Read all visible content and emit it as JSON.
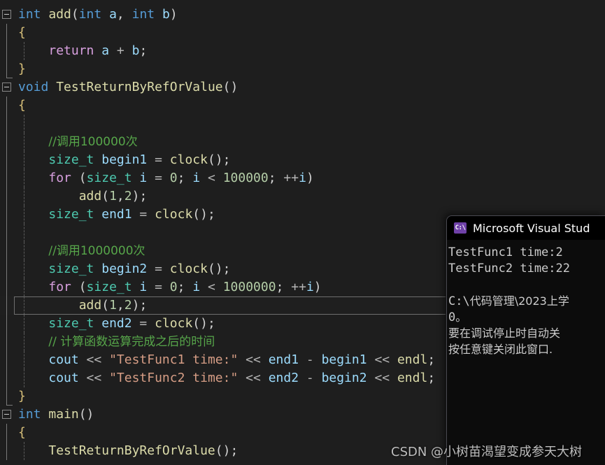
{
  "editor": {
    "background": "#1e1e1e",
    "colors": {
      "keyword": "#569cd6",
      "control_keyword": "#d8a0df",
      "type": "#4ec9b0",
      "function": "#dcdcaa",
      "variable": "#9cdcfe",
      "number": "#b5cea8",
      "string": "#d69d85",
      "comment": "#57a64a",
      "punctuation": "#d4d4d4",
      "current_line_border": "#6e6e6e"
    },
    "lines": [
      {
        "n": 1,
        "fold": "open",
        "guide": "none",
        "tokens": [
          {
            "t": "int",
            "c": "kw"
          },
          {
            "t": " ",
            "c": "pun"
          },
          {
            "t": "add",
            "c": "fn"
          },
          {
            "t": "(",
            "c": "pun"
          },
          {
            "t": "int",
            "c": "kw"
          },
          {
            "t": " a",
            "c": "var"
          },
          {
            "t": ", ",
            "c": "pun"
          },
          {
            "t": "int",
            "c": "kw"
          },
          {
            "t": " b",
            "c": "var"
          },
          {
            "t": ")",
            "c": "pun"
          }
        ]
      },
      {
        "n": 2,
        "fold": "bar",
        "guide": "none",
        "tokens": [
          {
            "t": "{",
            "c": "brc"
          }
        ]
      },
      {
        "n": 3,
        "fold": "bar",
        "guide": "dash",
        "tokens": [
          {
            "t": "    ",
            "c": "pun"
          },
          {
            "t": "return",
            "c": "kw2"
          },
          {
            "t": " a ",
            "c": "var"
          },
          {
            "t": "+",
            "c": "op"
          },
          {
            "t": " b",
            "c": "var"
          },
          {
            "t": ";",
            "c": "pun"
          }
        ]
      },
      {
        "n": 4,
        "fold": "barend",
        "guide": "none",
        "tokens": [
          {
            "t": "}",
            "c": "brc"
          }
        ]
      },
      {
        "n": 5,
        "fold": "open",
        "guide": "none",
        "tokens": [
          {
            "t": "void",
            "c": "kw"
          },
          {
            "t": " ",
            "c": "pun"
          },
          {
            "t": "TestReturnByRefOrValue",
            "c": "fn"
          },
          {
            "t": "()",
            "c": "pun"
          }
        ]
      },
      {
        "n": 6,
        "fold": "bar",
        "guide": "none",
        "tokens": [
          {
            "t": "{",
            "c": "brc"
          }
        ]
      },
      {
        "n": 7,
        "fold": "bar",
        "guide": "dash",
        "tokens": []
      },
      {
        "n": 8,
        "fold": "bar",
        "guide": "dash",
        "tokens": [
          {
            "t": "    ",
            "c": "pun"
          },
          {
            "t": "//调用100000次",
            "c": "cmt cjk"
          }
        ]
      },
      {
        "n": 9,
        "fold": "bar",
        "guide": "dash",
        "tokens": [
          {
            "t": "    ",
            "c": "pun"
          },
          {
            "t": "size_t",
            "c": "type"
          },
          {
            "t": " begin1 ",
            "c": "var"
          },
          {
            "t": "=",
            "c": "op"
          },
          {
            "t": " ",
            "c": "pun"
          },
          {
            "t": "clock",
            "c": "fn"
          },
          {
            "t": "()",
            "c": "pun"
          },
          {
            "t": ";",
            "c": "pun"
          }
        ]
      },
      {
        "n": 10,
        "fold": "bar",
        "guide": "dash",
        "tokens": [
          {
            "t": "    ",
            "c": "pun"
          },
          {
            "t": "for",
            "c": "kw2"
          },
          {
            "t": " (",
            "c": "pun"
          },
          {
            "t": "size_t",
            "c": "type"
          },
          {
            "t": " i ",
            "c": "var"
          },
          {
            "t": "=",
            "c": "op"
          },
          {
            "t": " ",
            "c": "pun"
          },
          {
            "t": "0",
            "c": "num"
          },
          {
            "t": "; ",
            "c": "pun"
          },
          {
            "t": "i ",
            "c": "var"
          },
          {
            "t": "<",
            "c": "op"
          },
          {
            "t": " ",
            "c": "pun"
          },
          {
            "t": "100000",
            "c": "num"
          },
          {
            "t": "; ",
            "c": "pun"
          },
          {
            "t": "++",
            "c": "op"
          },
          {
            "t": "i",
            "c": "var"
          },
          {
            "t": ")",
            "c": "pun"
          }
        ]
      },
      {
        "n": 11,
        "fold": "bar",
        "guide": "dash",
        "tokens": [
          {
            "t": "        ",
            "c": "pun"
          },
          {
            "t": "add",
            "c": "fn"
          },
          {
            "t": "(",
            "c": "pun"
          },
          {
            "t": "1",
            "c": "num"
          },
          {
            "t": ",",
            "c": "pun"
          },
          {
            "t": "2",
            "c": "num"
          },
          {
            "t": ")",
            "c": "pun"
          },
          {
            "t": ";",
            "c": "pun"
          }
        ]
      },
      {
        "n": 12,
        "fold": "bar",
        "guide": "dash",
        "tokens": [
          {
            "t": "    ",
            "c": "pun"
          },
          {
            "t": "size_t",
            "c": "type"
          },
          {
            "t": " end1 ",
            "c": "var"
          },
          {
            "t": "=",
            "c": "op"
          },
          {
            "t": " ",
            "c": "pun"
          },
          {
            "t": "clock",
            "c": "fn"
          },
          {
            "t": "()",
            "c": "pun"
          },
          {
            "t": ";",
            "c": "pun"
          }
        ]
      },
      {
        "n": 13,
        "fold": "bar",
        "guide": "dash",
        "tokens": []
      },
      {
        "n": 14,
        "fold": "bar",
        "guide": "dash",
        "tokens": [
          {
            "t": "    ",
            "c": "pun"
          },
          {
            "t": "//调用1000000次",
            "c": "cmt cjk"
          }
        ]
      },
      {
        "n": 15,
        "fold": "bar",
        "guide": "dash",
        "tokens": [
          {
            "t": "    ",
            "c": "pun"
          },
          {
            "t": "size_t",
            "c": "type"
          },
          {
            "t": " begin2 ",
            "c": "var"
          },
          {
            "t": "=",
            "c": "op"
          },
          {
            "t": " ",
            "c": "pun"
          },
          {
            "t": "clock",
            "c": "fn"
          },
          {
            "t": "()",
            "c": "pun"
          },
          {
            "t": ";",
            "c": "pun"
          }
        ]
      },
      {
        "n": 16,
        "fold": "bar",
        "guide": "dash",
        "tokens": [
          {
            "t": "    ",
            "c": "pun"
          },
          {
            "t": "for",
            "c": "kw2"
          },
          {
            "t": " (",
            "c": "pun"
          },
          {
            "t": "size_t",
            "c": "type"
          },
          {
            "t": " i ",
            "c": "var"
          },
          {
            "t": "=",
            "c": "op"
          },
          {
            "t": " ",
            "c": "pun"
          },
          {
            "t": "0",
            "c": "num"
          },
          {
            "t": "; ",
            "c": "pun"
          },
          {
            "t": "i ",
            "c": "var"
          },
          {
            "t": "<",
            "c": "op"
          },
          {
            "t": " ",
            "c": "pun"
          },
          {
            "t": "1000000",
            "c": "num"
          },
          {
            "t": "; ",
            "c": "pun"
          },
          {
            "t": "++",
            "c": "op"
          },
          {
            "t": "i",
            "c": "var"
          },
          {
            "t": ")",
            "c": "pun"
          }
        ]
      },
      {
        "n": 17,
        "fold": "bar",
        "guide": "dash",
        "current": true,
        "tokens": [
          {
            "t": "        ",
            "c": "pun"
          },
          {
            "t": "add",
            "c": "fn"
          },
          {
            "t": "(",
            "c": "pun"
          },
          {
            "t": "1",
            "c": "num"
          },
          {
            "t": ",",
            "c": "pun"
          },
          {
            "t": "2",
            "c": "num"
          },
          {
            "t": ")",
            "c": "pun"
          },
          {
            "t": ";",
            "c": "pun"
          }
        ]
      },
      {
        "n": 18,
        "fold": "bar",
        "guide": "dash",
        "tokens": [
          {
            "t": "    ",
            "c": "pun"
          },
          {
            "t": "size_t",
            "c": "type"
          },
          {
            "t": " end2 ",
            "c": "var"
          },
          {
            "t": "=",
            "c": "op"
          },
          {
            "t": " ",
            "c": "pun"
          },
          {
            "t": "clock",
            "c": "fn"
          },
          {
            "t": "()",
            "c": "pun"
          },
          {
            "t": ";",
            "c": "pun"
          }
        ]
      },
      {
        "n": 19,
        "fold": "bar",
        "guide": "dash",
        "tokens": [
          {
            "t": "    ",
            "c": "pun"
          },
          {
            "t": "// 计算函数运算完成之后的时间",
            "c": "cmt cjk"
          }
        ]
      },
      {
        "n": 20,
        "fold": "bar",
        "guide": "dash",
        "tokens": [
          {
            "t": "    ",
            "c": "pun"
          },
          {
            "t": "cout ",
            "c": "var"
          },
          {
            "t": "<<",
            "c": "op"
          },
          {
            "t": " ",
            "c": "pun"
          },
          {
            "t": "\"TestFunc1 time:\"",
            "c": "str"
          },
          {
            "t": " ",
            "c": "pun"
          },
          {
            "t": "<<",
            "c": "op"
          },
          {
            "t": " ",
            "c": "pun"
          },
          {
            "t": "end1",
            "c": "var"
          },
          {
            "t": " - ",
            "c": "op"
          },
          {
            "t": "begin1",
            "c": "var"
          },
          {
            "t": " ",
            "c": "pun"
          },
          {
            "t": "<<",
            "c": "op"
          },
          {
            "t": " ",
            "c": "pun"
          },
          {
            "t": "endl",
            "c": "fn"
          },
          {
            "t": ";",
            "c": "pun"
          }
        ]
      },
      {
        "n": 21,
        "fold": "bar",
        "guide": "dash",
        "tokens": [
          {
            "t": "    ",
            "c": "pun"
          },
          {
            "t": "cout ",
            "c": "var"
          },
          {
            "t": "<<",
            "c": "op"
          },
          {
            "t": " ",
            "c": "pun"
          },
          {
            "t": "\"TestFunc2 time:\"",
            "c": "str"
          },
          {
            "t": " ",
            "c": "pun"
          },
          {
            "t": "<<",
            "c": "op"
          },
          {
            "t": " ",
            "c": "pun"
          },
          {
            "t": "end2",
            "c": "var"
          },
          {
            "t": " - ",
            "c": "op"
          },
          {
            "t": "begin2",
            "c": "var"
          },
          {
            "t": " ",
            "c": "pun"
          },
          {
            "t": "<<",
            "c": "op"
          },
          {
            "t": " ",
            "c": "pun"
          },
          {
            "t": "endl",
            "c": "fn"
          },
          {
            "t": ";",
            "c": "pun"
          }
        ]
      },
      {
        "n": 22,
        "fold": "barend",
        "guide": "none",
        "tokens": [
          {
            "t": "}",
            "c": "brc"
          }
        ]
      },
      {
        "n": 23,
        "fold": "open",
        "guide": "none",
        "tokens": [
          {
            "t": "int",
            "c": "kw"
          },
          {
            "t": " ",
            "c": "pun"
          },
          {
            "t": "main",
            "c": "fn"
          },
          {
            "t": "()",
            "c": "pun"
          }
        ]
      },
      {
        "n": 24,
        "fold": "bar",
        "guide": "none",
        "tokens": [
          {
            "t": "{",
            "c": "brc"
          }
        ]
      },
      {
        "n": 25,
        "fold": "bar",
        "guide": "dash",
        "tokens": [
          {
            "t": "    ",
            "c": "pun"
          },
          {
            "t": "TestReturnByRefOrValue",
            "c": "fn"
          },
          {
            "t": "()",
            "c": "pun"
          },
          {
            "t": ";",
            "c": "pun"
          }
        ]
      }
    ]
  },
  "console": {
    "icon_name": "cmd-icon",
    "icon_text": "C:\\",
    "title": "Microsoft Visual Stud",
    "output_lines": [
      "TestFunc1 time:2",
      "TestFunc2 time:22",
      "",
      "C:\\代码管理\\2023上学",
      "0。",
      "要在调试停止时自动关",
      "按任意键关闭此窗口."
    ]
  },
  "watermark": {
    "text": "CSDN @小树苗渴望变成参天大树"
  }
}
